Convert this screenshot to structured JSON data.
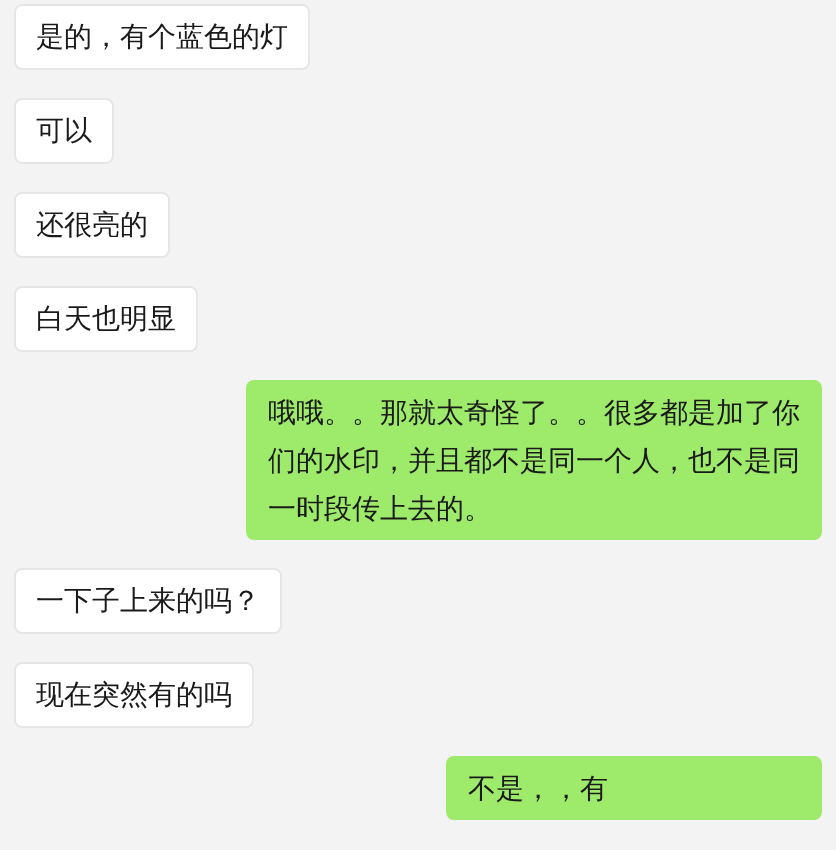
{
  "messages": [
    {
      "kind": "received",
      "text": "是的，有个蓝色的灯"
    },
    {
      "kind": "received",
      "text": "可以"
    },
    {
      "kind": "received",
      "text": "还很亮的"
    },
    {
      "kind": "received",
      "text": "白天也明显"
    },
    {
      "kind": "sent",
      "text": "哦哦。。那就太奇怪了。。很多都是加了你们的水印，并且都不是同一个人，也不是同一时段传上去的。"
    },
    {
      "kind": "received",
      "text": "一下子上来的吗？"
    },
    {
      "kind": "received",
      "text": "现在突然有的吗"
    },
    {
      "kind": "sent",
      "text": "不是，，有"
    }
  ]
}
